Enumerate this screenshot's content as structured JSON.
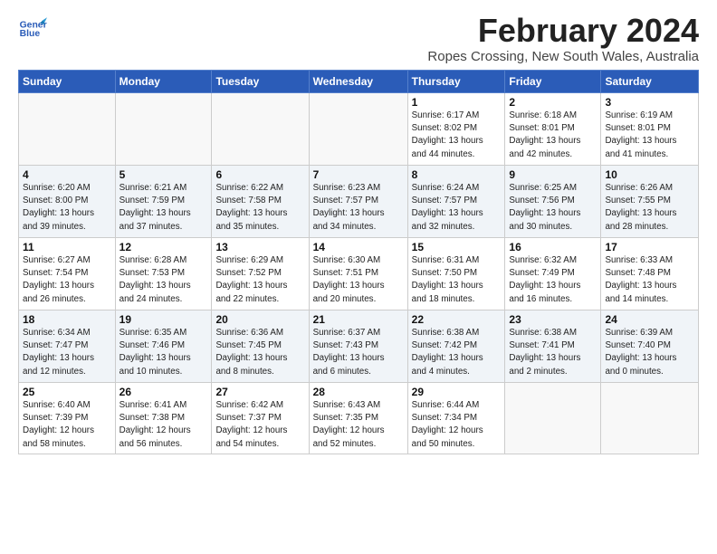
{
  "logo": {
    "line1": "General",
    "line2": "Blue"
  },
  "title": "February 2024",
  "subtitle": "Ropes Crossing, New South Wales, Australia",
  "weekdays": [
    "Sunday",
    "Monday",
    "Tuesday",
    "Wednesday",
    "Thursday",
    "Friday",
    "Saturday"
  ],
  "weeks": [
    [
      {
        "day": "",
        "info": ""
      },
      {
        "day": "",
        "info": ""
      },
      {
        "day": "",
        "info": ""
      },
      {
        "day": "",
        "info": ""
      },
      {
        "day": "1",
        "info": "Sunrise: 6:17 AM\nSunset: 8:02 PM\nDaylight: 13 hours\nand 44 minutes."
      },
      {
        "day": "2",
        "info": "Sunrise: 6:18 AM\nSunset: 8:01 PM\nDaylight: 13 hours\nand 42 minutes."
      },
      {
        "day": "3",
        "info": "Sunrise: 6:19 AM\nSunset: 8:01 PM\nDaylight: 13 hours\nand 41 minutes."
      }
    ],
    [
      {
        "day": "4",
        "info": "Sunrise: 6:20 AM\nSunset: 8:00 PM\nDaylight: 13 hours\nand 39 minutes."
      },
      {
        "day": "5",
        "info": "Sunrise: 6:21 AM\nSunset: 7:59 PM\nDaylight: 13 hours\nand 37 minutes."
      },
      {
        "day": "6",
        "info": "Sunrise: 6:22 AM\nSunset: 7:58 PM\nDaylight: 13 hours\nand 35 minutes."
      },
      {
        "day": "7",
        "info": "Sunrise: 6:23 AM\nSunset: 7:57 PM\nDaylight: 13 hours\nand 34 minutes."
      },
      {
        "day": "8",
        "info": "Sunrise: 6:24 AM\nSunset: 7:57 PM\nDaylight: 13 hours\nand 32 minutes."
      },
      {
        "day": "9",
        "info": "Sunrise: 6:25 AM\nSunset: 7:56 PM\nDaylight: 13 hours\nand 30 minutes."
      },
      {
        "day": "10",
        "info": "Sunrise: 6:26 AM\nSunset: 7:55 PM\nDaylight: 13 hours\nand 28 minutes."
      }
    ],
    [
      {
        "day": "11",
        "info": "Sunrise: 6:27 AM\nSunset: 7:54 PM\nDaylight: 13 hours\nand 26 minutes."
      },
      {
        "day": "12",
        "info": "Sunrise: 6:28 AM\nSunset: 7:53 PM\nDaylight: 13 hours\nand 24 minutes."
      },
      {
        "day": "13",
        "info": "Sunrise: 6:29 AM\nSunset: 7:52 PM\nDaylight: 13 hours\nand 22 minutes."
      },
      {
        "day": "14",
        "info": "Sunrise: 6:30 AM\nSunset: 7:51 PM\nDaylight: 13 hours\nand 20 minutes."
      },
      {
        "day": "15",
        "info": "Sunrise: 6:31 AM\nSunset: 7:50 PM\nDaylight: 13 hours\nand 18 minutes."
      },
      {
        "day": "16",
        "info": "Sunrise: 6:32 AM\nSunset: 7:49 PM\nDaylight: 13 hours\nand 16 minutes."
      },
      {
        "day": "17",
        "info": "Sunrise: 6:33 AM\nSunset: 7:48 PM\nDaylight: 13 hours\nand 14 minutes."
      }
    ],
    [
      {
        "day": "18",
        "info": "Sunrise: 6:34 AM\nSunset: 7:47 PM\nDaylight: 13 hours\nand 12 minutes."
      },
      {
        "day": "19",
        "info": "Sunrise: 6:35 AM\nSunset: 7:46 PM\nDaylight: 13 hours\nand 10 minutes."
      },
      {
        "day": "20",
        "info": "Sunrise: 6:36 AM\nSunset: 7:45 PM\nDaylight: 13 hours\nand 8 minutes."
      },
      {
        "day": "21",
        "info": "Sunrise: 6:37 AM\nSunset: 7:43 PM\nDaylight: 13 hours\nand 6 minutes."
      },
      {
        "day": "22",
        "info": "Sunrise: 6:38 AM\nSunset: 7:42 PM\nDaylight: 13 hours\nand 4 minutes."
      },
      {
        "day": "23",
        "info": "Sunrise: 6:38 AM\nSunset: 7:41 PM\nDaylight: 13 hours\nand 2 minutes."
      },
      {
        "day": "24",
        "info": "Sunrise: 6:39 AM\nSunset: 7:40 PM\nDaylight: 13 hours\nand 0 minutes."
      }
    ],
    [
      {
        "day": "25",
        "info": "Sunrise: 6:40 AM\nSunset: 7:39 PM\nDaylight: 12 hours\nand 58 minutes."
      },
      {
        "day": "26",
        "info": "Sunrise: 6:41 AM\nSunset: 7:38 PM\nDaylight: 12 hours\nand 56 minutes."
      },
      {
        "day": "27",
        "info": "Sunrise: 6:42 AM\nSunset: 7:37 PM\nDaylight: 12 hours\nand 54 minutes."
      },
      {
        "day": "28",
        "info": "Sunrise: 6:43 AM\nSunset: 7:35 PM\nDaylight: 12 hours\nand 52 minutes."
      },
      {
        "day": "29",
        "info": "Sunrise: 6:44 AM\nSunset: 7:34 PM\nDaylight: 12 hours\nand 50 minutes."
      },
      {
        "day": "",
        "info": ""
      },
      {
        "day": "",
        "info": ""
      }
    ]
  ]
}
